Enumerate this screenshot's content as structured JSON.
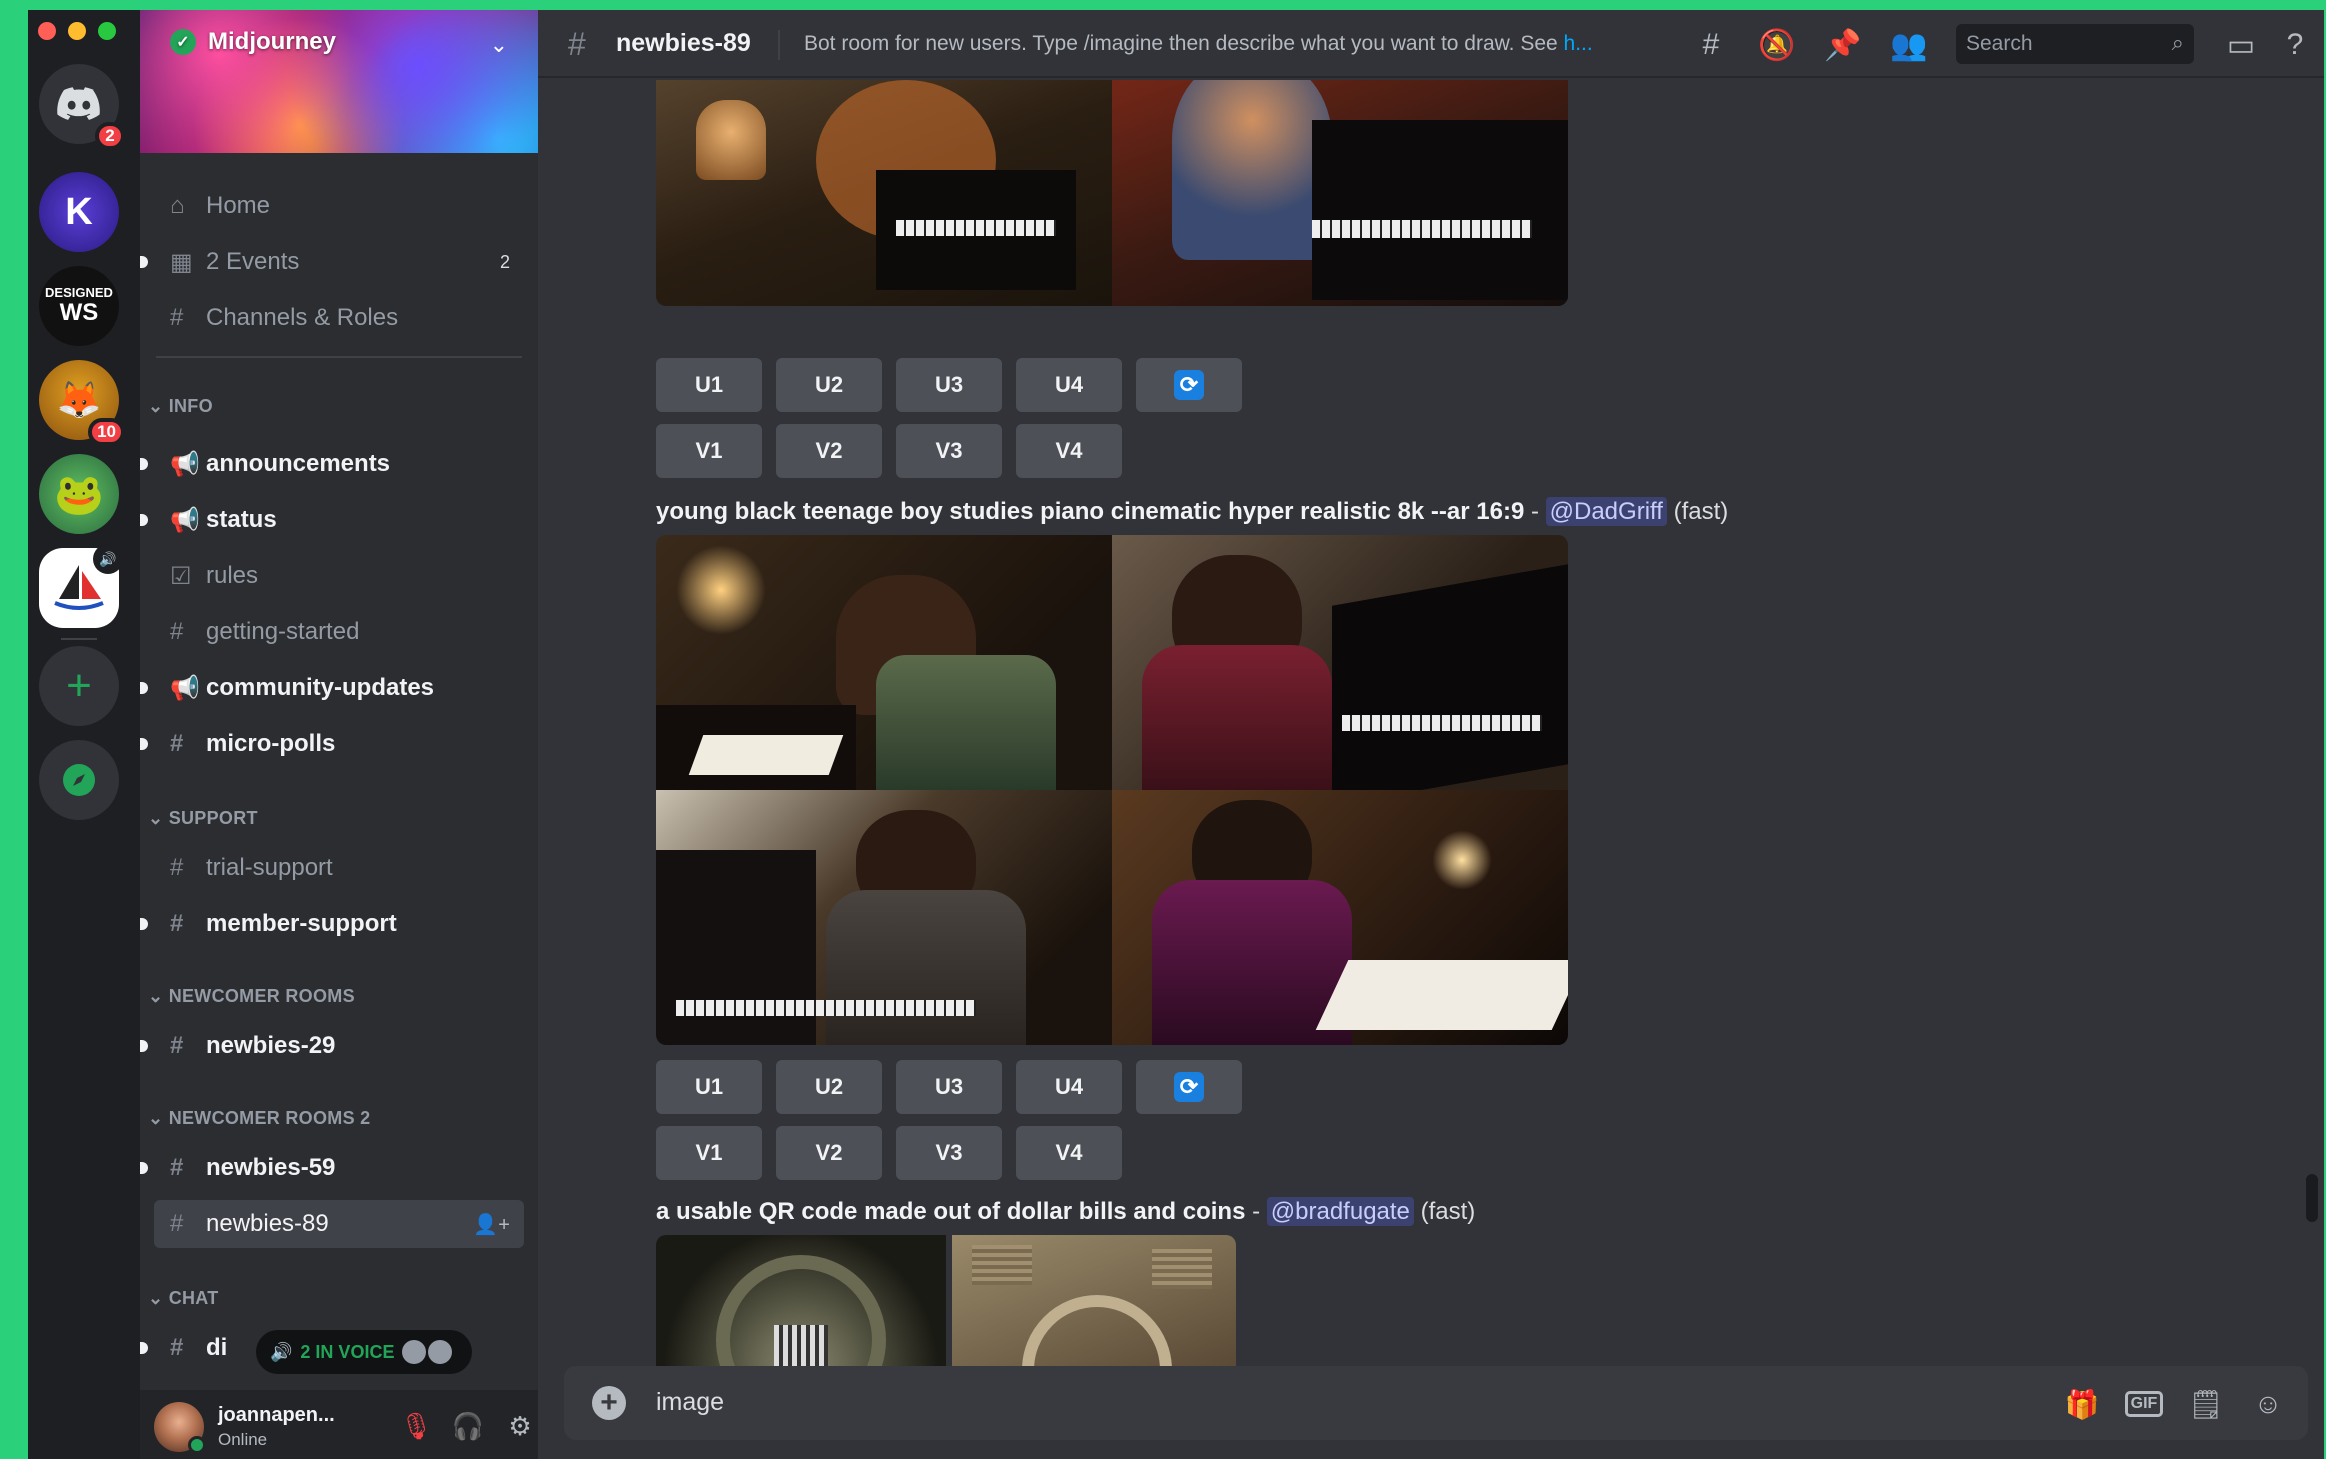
{
  "server": {
    "name": "Midjourney",
    "notification_badges": [
      "2",
      "10"
    ]
  },
  "sidebar": {
    "top_items": [
      {
        "label": "Home"
      },
      {
        "label": "2 Events",
        "count": "2"
      },
      {
        "label": "Channels & Roles"
      }
    ],
    "categories": {
      "info": "INFO",
      "support": "SUPPORT",
      "newcomer": "NEWCOMER ROOMS",
      "newcomer2": "NEWCOMER ROOMS 2",
      "chat": "CHAT"
    },
    "channels": {
      "announcements": "announcements",
      "status": "status",
      "rules": "rules",
      "getting_started": "getting-started",
      "community_updates": "community-updates",
      "micro_polls": "micro-polls",
      "trial_support": "trial-support",
      "member_support": "member-support",
      "newbies_29": "newbies-29",
      "newbies_59": "newbies-59",
      "newbies_89": "newbies-89",
      "discussion_partial": "di"
    },
    "voice_pill": "2 IN VOICE"
  },
  "user": {
    "name": "joannapen...",
    "status": "Online"
  },
  "header": {
    "channel": "newbies-89",
    "topic": "Bot room for new users. Type /imagine then describe what you want to draw. See ",
    "topic_link": "h...",
    "search_placeholder": "Search"
  },
  "messages": [
    {
      "buttons_u": [
        "U1",
        "U2",
        "U3",
        "U4"
      ],
      "buttons_v": [
        "V1",
        "V2",
        "V3",
        "V4"
      ]
    },
    {
      "prompt": "young black teenage boy studies piano cinematic hyper realistic 8k --ar 16:9",
      "dash": " - ",
      "author": "@DadGriff",
      "mode": " (fast)",
      "buttons_u": [
        "U1",
        "U2",
        "U3",
        "U4"
      ],
      "buttons_v": [
        "V1",
        "V2",
        "V3",
        "V4"
      ]
    },
    {
      "prompt": "a usable QR code made out of dollar bills and coins",
      "dash": " - ",
      "author": "@bradfugate",
      "mode": " (fast)"
    }
  ],
  "composer": {
    "value": "image"
  }
}
